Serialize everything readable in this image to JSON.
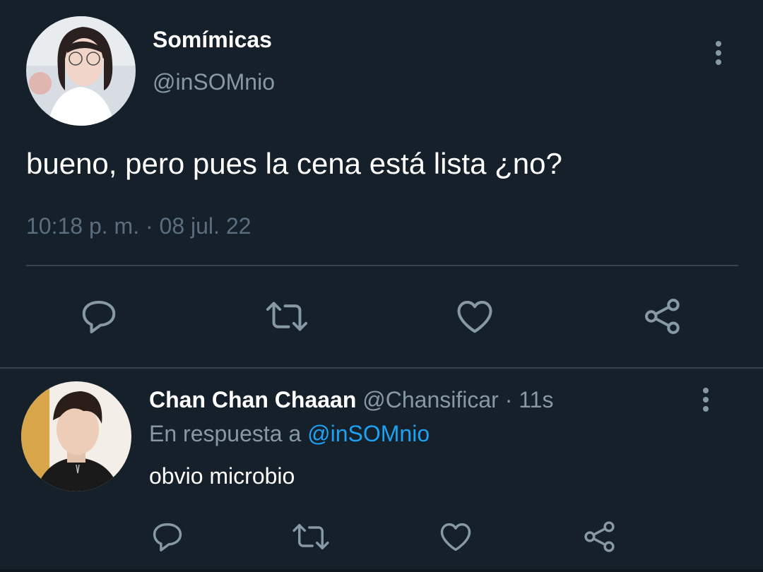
{
  "tweet": {
    "author": {
      "name": "Somímicas",
      "handle": "@inSOMnio"
    },
    "text": "bueno, pero pues la cena está lista ¿no?",
    "meta": "10:18 p. m. · 08 jul. 22"
  },
  "reply": {
    "author": {
      "name": "Chan Chan Chaaan",
      "handle": "@Chansificar",
      "separator": " · ",
      "time": "11s"
    },
    "reply_to_label": "En respuesta a ",
    "reply_to_mention": "@inSOMnio",
    "text": "obvio microbio"
  },
  "icons": [
    "reply-icon",
    "retweet-icon",
    "like-icon",
    "share-icon",
    "more-icon"
  ],
  "colors": {
    "background": "#15202b",
    "secondary_text": "#8899a6",
    "icon": "#8899a6",
    "mention": "#1da1f2",
    "divider": "#38444d"
  }
}
